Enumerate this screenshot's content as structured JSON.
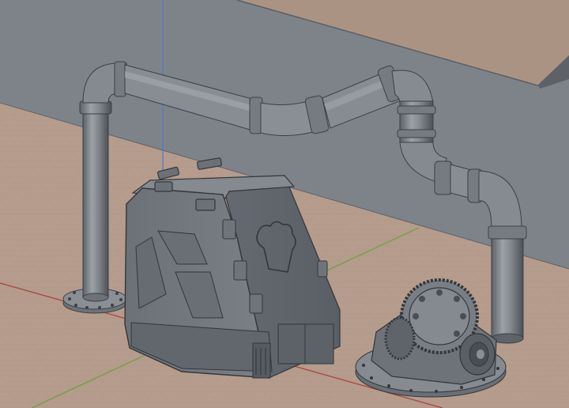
{
  "viewport": {
    "kind": "3d-modeling-viewport",
    "shading": "solid-gray",
    "overlays": [
      "grid-floor",
      "x-axis-red",
      "y-axis-green",
      "z-axis-blue"
    ],
    "objects": [
      "back-wall",
      "wall-ledge",
      "pipe-assembly",
      "armored-crate",
      "differential-gear"
    ]
  },
  "colors": {
    "wall": "#7e838a",
    "floor": "#b59c8c",
    "ledge": "#ab9384",
    "model": "#73787f",
    "x_axis": "#b03d3d",
    "y_axis": "#6aa03c",
    "z_axis": "#4f79c4"
  }
}
